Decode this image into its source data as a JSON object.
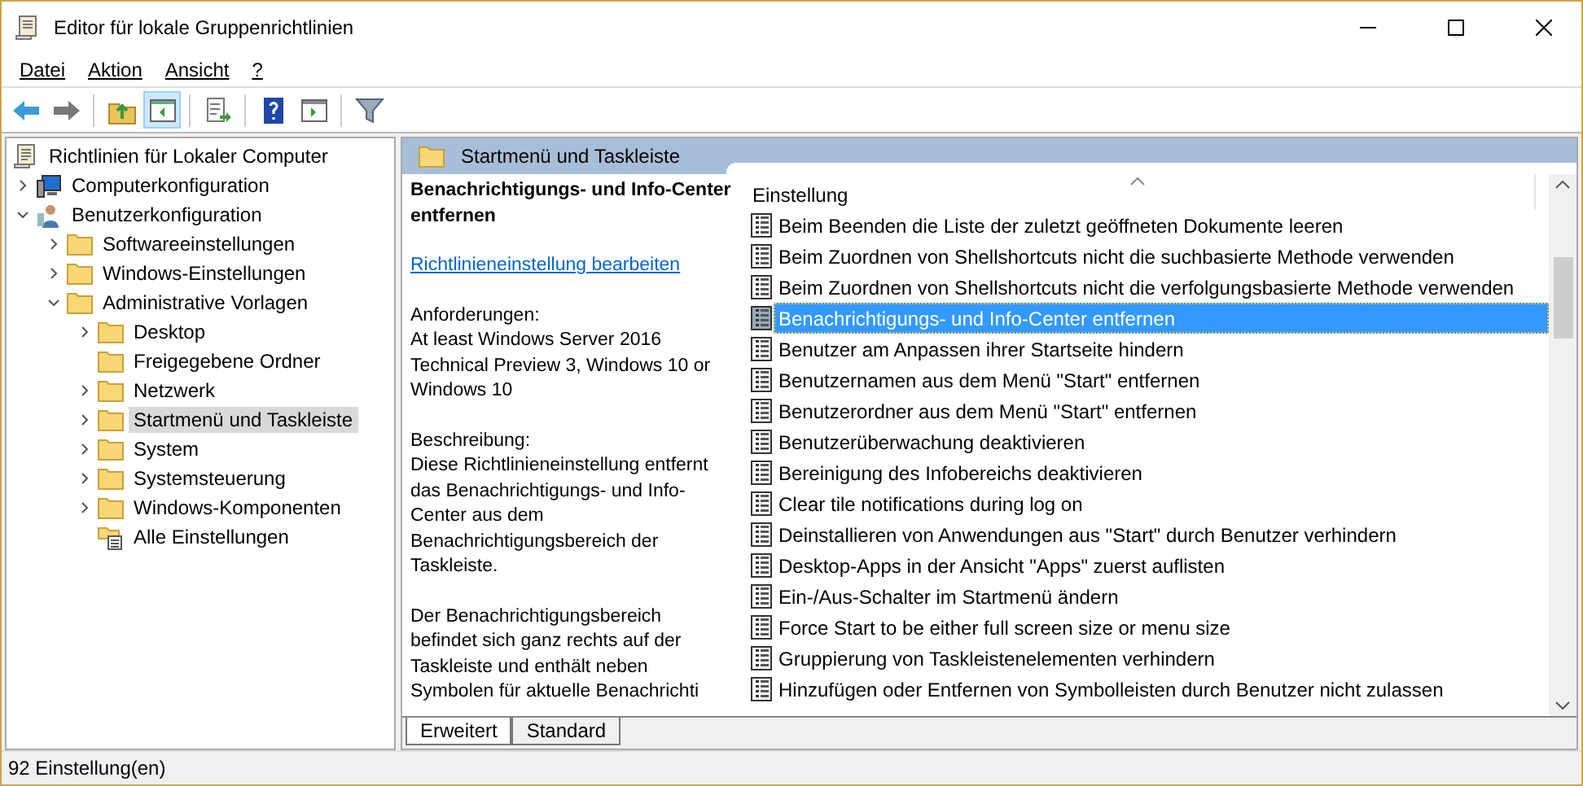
{
  "window": {
    "title": "Editor für lokale Gruppenrichtlinien"
  },
  "menu": [
    "Datei",
    "Aktion",
    "Ansicht",
    "?"
  ],
  "toolbar": [
    {
      "kind": "back",
      "selected": false
    },
    {
      "kind": "forward",
      "selected": false
    },
    {
      "kind": "sep"
    },
    {
      "kind": "up",
      "selected": false
    },
    {
      "kind": "pane",
      "selected": true
    },
    {
      "kind": "sep"
    },
    {
      "kind": "export",
      "selected": false
    },
    {
      "kind": "sep"
    },
    {
      "kind": "help",
      "selected": false
    },
    {
      "kind": "view",
      "selected": false
    },
    {
      "kind": "sep"
    },
    {
      "kind": "filter",
      "selected": false
    }
  ],
  "tree": [
    {
      "label": "Richtlinien für Lokaler Computer",
      "kind": "policy",
      "selected": false,
      "children": [
        {
          "label": "Computerkonfiguration",
          "kind": "computer",
          "expanded": false,
          "selected": false
        },
        {
          "label": "Benutzerkonfiguration",
          "kind": "user",
          "expanded": true,
          "selected": false,
          "children": [
            {
              "label": "Softwareeinstellungen",
              "kind": "folder",
              "expanded": false,
              "selected": false
            },
            {
              "label": "Windows-Einstellungen",
              "kind": "folder",
              "expanded": false,
              "selected": false
            },
            {
              "label": "Administrative Vorlagen",
              "kind": "folder",
              "expanded": true,
              "selected": false,
              "children": [
                {
                  "label": "Desktop",
                  "kind": "folder",
                  "expanded": false,
                  "selected": false
                },
                {
                  "label": "Freigegebene Ordner",
                  "kind": "folder",
                  "selected": false
                },
                {
                  "label": "Netzwerk",
                  "kind": "folder",
                  "expanded": false,
                  "selected": false
                },
                {
                  "label": "Startmenü und Taskleiste",
                  "kind": "folder",
                  "expanded": false,
                  "selected": true
                },
                {
                  "label": "System",
                  "kind": "folder",
                  "expanded": false,
                  "selected": false
                },
                {
                  "label": "Systemsteuerung",
                  "kind": "folder",
                  "expanded": false,
                  "selected": false
                },
                {
                  "label": "Windows-Komponenten",
                  "kind": "folder",
                  "expanded": false,
                  "selected": false
                },
                {
                  "label": "Alle Einstellungen",
                  "kind": "all",
                  "selected": false
                }
              ]
            }
          ]
        }
      ]
    }
  ],
  "pane": {
    "title": "Startmenü und Taskleiste",
    "description": {
      "heading": "Benachrichtigungs- und Info-Center entfernen",
      "link": "Richtlinieneinstellung bearbeiten",
      "requirements_label": "Anforderungen:",
      "requirements": "At least Windows Server 2016 Technical Preview 3, Windows 10 or Windows 10",
      "description_label": "Beschreibung:",
      "description": "Diese Richtlinieneinstellung entfernt das Benachrichtigungs- und Info-Center aus dem Benachrichtigungsbereich der Taskleiste.",
      "more": "Der Benachrichtigungsbereich befindet sich ganz rechts auf der Taskleiste und enthält neben Symbolen für aktuelle Benachrichti"
    },
    "column": "Einstellung",
    "settings": [
      {
        "label": "Beim Beenden die Liste der zuletzt geöffneten Dokumente leeren",
        "selected": false
      },
      {
        "label": "Beim Zuordnen von Shellshortcuts nicht die suchbasierte Methode verwenden",
        "selected": false
      },
      {
        "label": "Beim Zuordnen von Shellshortcuts nicht die verfolgungsbasierte Methode verwenden",
        "selected": false
      },
      {
        "label": "Benachrichtigungs- und Info-Center entfernen",
        "selected": true
      },
      {
        "label": "Benutzer am Anpassen ihrer Startseite hindern",
        "selected": false
      },
      {
        "label": "Benutzernamen aus dem Menü \"Start\" entfernen",
        "selected": false
      },
      {
        "label": "Benutzerordner aus dem Menü \"Start\" entfernen",
        "selected": false
      },
      {
        "label": "Benutzerüberwachung deaktivieren",
        "selected": false
      },
      {
        "label": "Bereinigung des Infobereichs deaktivieren",
        "selected": false
      },
      {
        "label": "Clear tile notifications during log on",
        "selected": false
      },
      {
        "label": "Deinstallieren von Anwendungen aus \"Start\" durch Benutzer verhindern",
        "selected": false
      },
      {
        "label": "Desktop-Apps in der Ansicht \"Apps\" zuerst auflisten",
        "selected": false
      },
      {
        "label": "Ein-/Aus-Schalter im Startmenü ändern",
        "selected": false
      },
      {
        "label": "Force Start to be either full screen size or menu size",
        "selected": false
      },
      {
        "label": "Gruppierung von Taskleistenelementen verhindern",
        "selected": false
      },
      {
        "label": "Hinzufügen oder Entfernen von Symbolleisten durch Benutzer nicht zulassen",
        "selected": false
      }
    ],
    "tabs": [
      {
        "label": "Erweitert",
        "selected": true
      },
      {
        "label": "Standard",
        "selected": false
      }
    ]
  },
  "status_bar": "92 Einstellung(en)"
}
